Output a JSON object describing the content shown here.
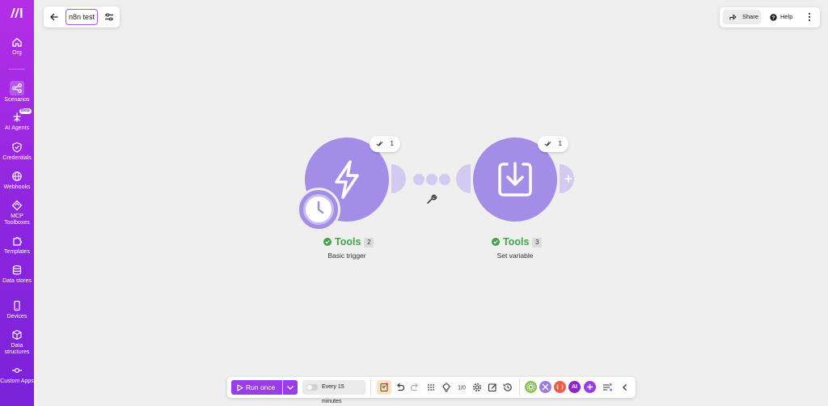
{
  "colors": {
    "sidebar_top": "#b52ee6",
    "sidebar_bottom": "#7a22d9",
    "node_fill": "#a48de6",
    "success_green": "#45a24a",
    "run_button": "#9a3de8"
  },
  "sidebar": {
    "items": [
      {
        "label": "Org",
        "icon": "home-icon"
      },
      {
        "label": "Scenarios",
        "icon": "share-nodes-icon",
        "active": true
      },
      {
        "label": "AI Agents",
        "icon": "ai-agent-icon",
        "badge": "Beta"
      },
      {
        "label": "Credentials",
        "icon": "shield-icon"
      },
      {
        "label": "Webhooks",
        "icon": "globe-icon"
      },
      {
        "label": "MCP Toolboxes",
        "icon": "mcp-icon"
      },
      {
        "label": "Templates",
        "icon": "puzzle-icon"
      },
      {
        "label": "Data stores",
        "icon": "database-icon"
      },
      {
        "label": "Devices",
        "icon": "phone-icon"
      },
      {
        "label": "Data structures",
        "icon": "cube-icon"
      },
      {
        "label": "Custom Apps",
        "icon": "custom-app-icon"
      }
    ]
  },
  "header": {
    "scenario_name": "n8n test",
    "share_label": "Share",
    "help_label": "Help"
  },
  "nodes": [
    {
      "app": "Tools",
      "number": "2",
      "subtitle": "Basic trigger",
      "ops": "1",
      "icon": "lightning-icon"
    },
    {
      "app": "Tools",
      "number": "3",
      "subtitle": "Set variable",
      "ops": "1",
      "icon": "download-icon"
    }
  ],
  "toolbar": {
    "run_label": "Run once",
    "schedule_label": "Every 15 minutes",
    "ai_label": "AI"
  }
}
